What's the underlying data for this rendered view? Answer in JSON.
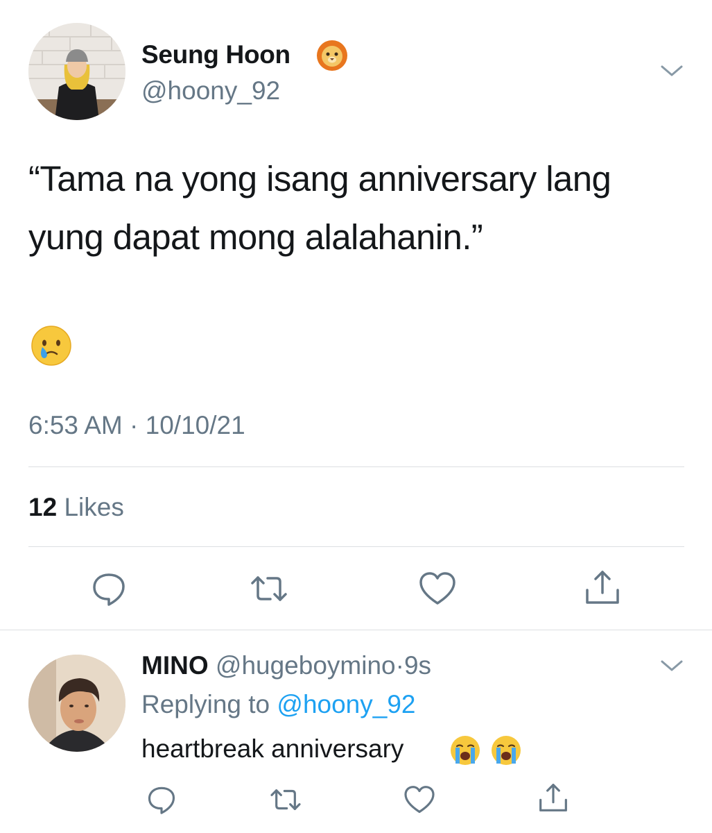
{
  "main_tweet": {
    "author_name": "Seung Hoon",
    "author_handle": "@hoony_92",
    "badge_icon": "lion-face-emoji",
    "text_line1": "“Tama na yong isang anniversary lang",
    "text_line2": "yung dapat mong alalahanin.”",
    "emoji": "face-holding-back-tears-emoji",
    "timestamp": "6:53 AM · 10/10/21",
    "likes_count": "12",
    "likes_label": "Likes",
    "actions": [
      "reply-icon",
      "retweet-icon",
      "like-icon",
      "share-icon"
    ]
  },
  "reply_tweet": {
    "author_name": "MINO",
    "author_handle": "@hugeboymino",
    "separator": "·",
    "time_ago": "9s",
    "replying_prefix": "Replying to",
    "replying_mention": "@hoony_92",
    "text": "heartbreak anniversary",
    "emojis": [
      "loudly-crying-face-emoji",
      "loudly-crying-face-emoji"
    ],
    "actions": [
      "reply-icon",
      "retweet-icon",
      "like-icon",
      "share-icon"
    ]
  },
  "colors": {
    "text_primary": "#14171a",
    "text_secondary": "#657786",
    "link": "#1da1f2",
    "divider": "#dcdfe2"
  }
}
